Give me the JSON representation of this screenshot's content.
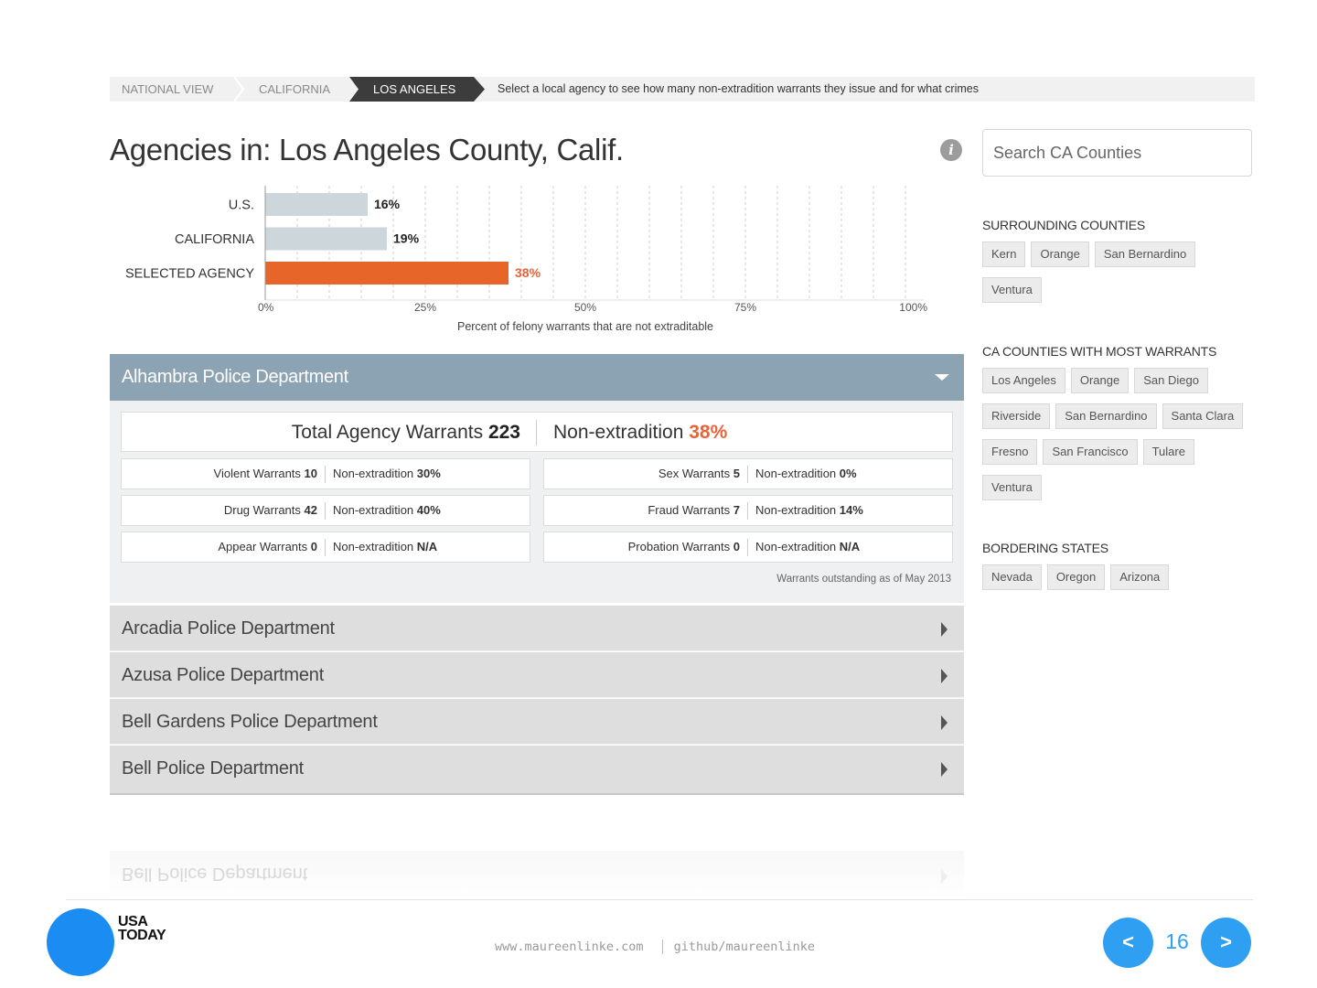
{
  "breadcrumb": {
    "items": [
      "NATIONAL VIEW",
      "CALIFORNIA",
      "LOS ANGELES"
    ],
    "hint": "Select a local agency to see how many non-extradition warrants they issue and for what crimes"
  },
  "title": "Agencies in: Los Angeles County, Calif.",
  "info_icon_glyph": "i",
  "search": {
    "placeholder": "Search CA Counties",
    "value": ""
  },
  "chart_data": {
    "type": "bar",
    "orientation": "horizontal",
    "categories": [
      "U.S.",
      "CALIFORNIA",
      "SELECTED AGENCY"
    ],
    "values": [
      16,
      19,
      38
    ],
    "value_labels": [
      "16%",
      "19%",
      "38%"
    ],
    "colors": [
      "#cdd6da",
      "#cdd6da",
      "#e8652a"
    ],
    "value_label_colors": [
      "#222222",
      "#222222",
      "#e5643a"
    ],
    "xlabel": "Percent of felony warrants that are not extraditable",
    "xlim": [
      0,
      100
    ],
    "xticks": [
      0,
      25,
      50,
      75,
      100
    ],
    "xtick_labels": [
      "0%",
      "25%",
      "50%",
      "75%",
      "100%"
    ],
    "minor_gridlines_every": 5,
    "grid": true
  },
  "selected_agency": {
    "name": "Alhambra Police Department",
    "total_label": "Total Agency Warrants",
    "total_value": "223",
    "nonext_label": "Non-extradition",
    "nonext_value": "38%",
    "categories": [
      {
        "label": "Violent Warrants",
        "count": "10",
        "ne_label": "Non-extradition",
        "ne_value": "30%"
      },
      {
        "label": "Sex Warrants",
        "count": "5",
        "ne_label": "Non-extradition",
        "ne_value": "0%"
      },
      {
        "label": "Drug Warrants",
        "count": "42",
        "ne_label": "Non-extradition",
        "ne_value": "40%"
      },
      {
        "label": "Fraud Warrants",
        "count": "7",
        "ne_label": "Non-extradition",
        "ne_value": "14%"
      },
      {
        "label": "Appear Warrants",
        "count": "0",
        "ne_label": "Non-extradition",
        "ne_value": "N/A"
      },
      {
        "label": "Probation Warrants",
        "count": "0",
        "ne_label": "Non-extradition",
        "ne_value": "N/A"
      }
    ],
    "as_of": "Warrants outstanding as of May 2013"
  },
  "agency_list": [
    "Arcadia Police Department",
    "Azusa Police Department",
    "Bell Gardens Police Department",
    "Bell Police Department"
  ],
  "reflection_label": "Bell Police Department",
  "sidebar": {
    "surrounding": {
      "heading": "SURROUNDING COUNTIES",
      "items": [
        "Kern",
        "Orange",
        "San Bernardino",
        "Ventura"
      ]
    },
    "most_warrants": {
      "heading": "CA COUNTIES WITH MOST WARRANTS",
      "items": [
        "Los Angeles",
        "Orange",
        "San Diego",
        "Riverside",
        "San Bernardino",
        "Santa Clara",
        "Fresno",
        "San Francisco",
        "Tulare",
        "Ventura"
      ]
    },
    "bordering": {
      "heading": "BORDERING STATES",
      "items": [
        "Nevada",
        "Oregon",
        "Arizona"
      ]
    }
  },
  "footer": {
    "logo_line1": "USA",
    "logo_line2": "TODAY",
    "website": "www.maureenlinke.com",
    "github": "github/maureenlinke",
    "prev": "<",
    "next": ">",
    "page": "16"
  },
  "colors": {
    "accent_orange": "#e8652a",
    "panel_header": "#8ca3b3",
    "usa_blue": "#1b8df2",
    "nav_blue": "#2f9ff2"
  }
}
